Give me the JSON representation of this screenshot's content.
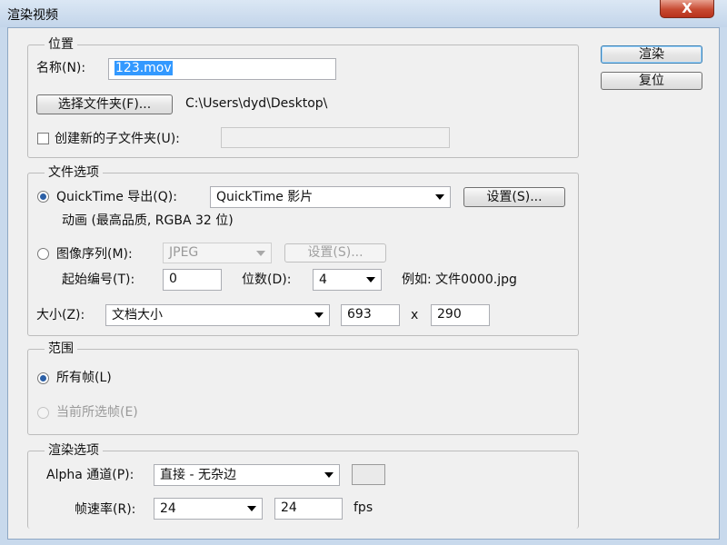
{
  "window": {
    "title": "渲染视频",
    "close_label": "X"
  },
  "buttons": {
    "render": "渲染",
    "reset": "复位"
  },
  "location": {
    "legend": "位置",
    "name_label": "名称(N):",
    "name_value": "123.mov",
    "choose_folder": "选择文件夹(F)...",
    "folder_path": "C:\\Users\\dyd\\Desktop\\",
    "create_subfolder_label": "创建新的子文件夹(U):",
    "create_subfolder_checked": false,
    "subfolder_value": ""
  },
  "file_options": {
    "legend": "文件选项",
    "quicktime_label": "QuickTime 导出(Q):",
    "quicktime_format": "QuickTime 影片",
    "settings_label": "设置(S)...",
    "quicktime_desc": "动画 (最高品质, RGBA 32 位)",
    "image_seq_label": "图像序列(M):",
    "image_seq_format": "JPEG",
    "image_seq_settings": "设置(S)...",
    "start_number_label": "起始编号(T):",
    "start_number_value": "0",
    "digits_label": "位数(D):",
    "digits_value": "4",
    "example_text": "例如: 文件0000.jpg",
    "size_label": "大小(Z):",
    "size_option": "文档大小",
    "width": "693",
    "times": "x",
    "height": "290"
  },
  "range": {
    "legend": "范围",
    "all_frames": "所有帧(L)",
    "current_selected": "当前所选帧(E)"
  },
  "render_options": {
    "legend": "渲染选项",
    "alpha_label": "Alpha 通道(P):",
    "alpha_option": "直接 - 无杂边",
    "frame_rate_label": "帧速率(R):",
    "frame_rate_option": "24",
    "frame_rate_value": "24",
    "fps": "fps"
  }
}
